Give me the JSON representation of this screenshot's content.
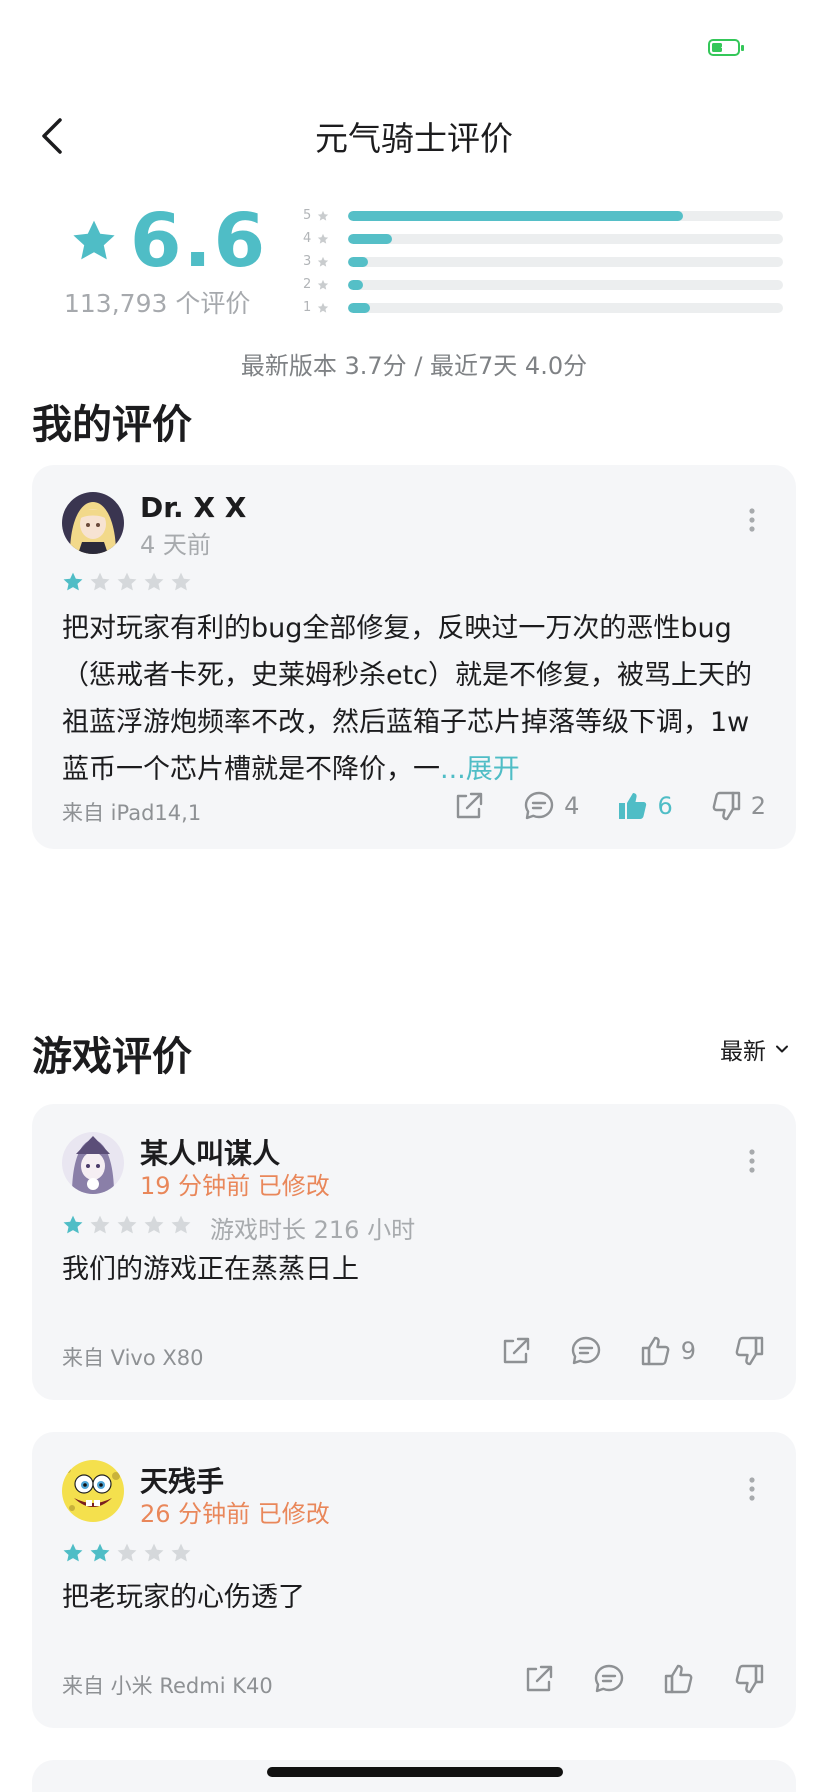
{
  "nav": {
    "title": "元气骑士评价"
  },
  "summary": {
    "score": "6.6",
    "rating_count": "113,793 个评价",
    "distribution": [
      {
        "label": "5",
        "fraction": 0.77
      },
      {
        "label": "4",
        "fraction": 0.1
      },
      {
        "label": "3",
        "fraction": 0.045
      },
      {
        "label": "2",
        "fraction": 0.035
      },
      {
        "label": "1",
        "fraction": 0.05
      }
    ],
    "version_line": "最新版本 3.7分 / 最近7天 4.0分",
    "accent_color": "#4fbdc6"
  },
  "my_review": {
    "section_title": "我的评价",
    "user": "Dr. X X",
    "time": "4 天前",
    "stars": 1,
    "text": "把对玩家有利的bug全部修复，反映过一万次的恶性bug（惩戒者卡死，史莱姆秒杀etc）就是不修复，被骂上天的祖蓝浮游炮频率不改，然后蓝箱子芯片掉落等级下调，1w蓝币一个芯片槽就是不降价，一",
    "expand_label": "...展开",
    "from": "来自 iPad14,1",
    "comments": "4",
    "likes": "6",
    "dislikes": "2"
  },
  "game_reviews": {
    "section_title": "游戏评价",
    "sort_label": "最新",
    "items": [
      {
        "user": "某人叫谋人",
        "time": "19 分钟前 已修改",
        "stars": 1,
        "playtime": "游戏时长 216 小时",
        "text": "我们的游戏正在蒸蒸日上",
        "from": "来自 Vivo X80",
        "likes": "9"
      },
      {
        "user": "天残手",
        "time": "26 分钟前 已修改",
        "stars": 2,
        "text": "把老玩家的心伤透了",
        "from": "来自 小米 Redmi K40"
      }
    ]
  },
  "icons": [
    "battery-icon",
    "back-icon",
    "star-icon",
    "more-icon",
    "share-icon",
    "comment-icon",
    "thumbs-up-icon",
    "thumbs-down-icon",
    "chevron-down-icon"
  ]
}
